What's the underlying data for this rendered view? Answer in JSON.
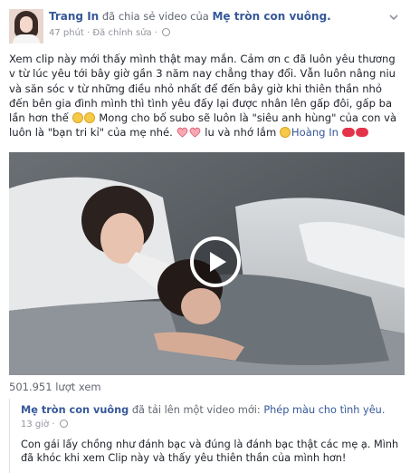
{
  "post": {
    "author": "Trang In",
    "action": "đã chia sẻ video của",
    "source_page": "Mẹ tròn con vuông.",
    "time": "47 phút",
    "separator": "·",
    "edited": "Đã chỉnh sửa",
    "caption_parts": [
      "Xem clip này mới thấy mình thật may mắn. Cảm ơn c đã luôn yêu thương v từ lúc yêu tới bây giờ gần 3 năm nay chẳng thay đổi. Vẫn luôn nâng niu và săn sóc v từ những điều nhỏ nhất để đến bây giờ khi thiên thần nhỏ đến bên gia đình mình thì tình yêu đấy lại được nhân lên gấp đôi, gấp ba lần hơn thế",
      " Mong cho bố subo sẽ luôn là \"siêu anh hùng\" của con và luôn là \"bạn tri kỉ\" của mẹ nhé. ",
      " lu và nhớ lắm ",
      "Hoàng In"
    ]
  },
  "video": {
    "views": "501.951 lượt xem"
  },
  "shared": {
    "page_name": "Mẹ tròn con vuông",
    "action": "đã tải lên một video mới:",
    "video_title": "Phép màu cho tình yêu.",
    "time": "13 giờ",
    "separator": "·",
    "text": "Con gái lấy chồng như đánh bạc và đúng là đánh bạc thật các mẹ ạ. Mình đã khóc khi xem Clip này và thấy yêu thiên thần của mình hơn!"
  },
  "icons": {
    "globe": "globe-icon",
    "chevron": "chevron-down-icon",
    "play": "play-icon"
  },
  "colors": {
    "link": "#365899",
    "meta": "#90949c",
    "text": "#1d2129"
  }
}
